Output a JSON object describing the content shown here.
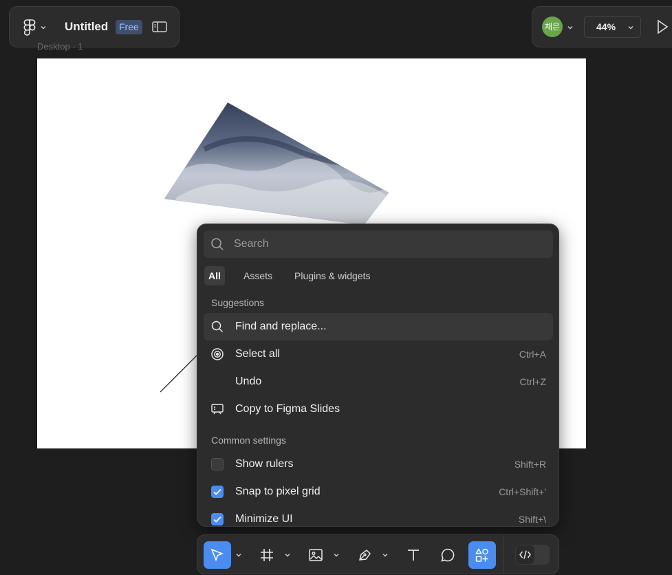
{
  "header": {
    "file_title": "Untitled",
    "plan_badge": "Free"
  },
  "toolbar_right": {
    "avatar_initials": "채은",
    "zoom_level": "44%"
  },
  "canvas": {
    "frame_name": "Desktop - 1"
  },
  "quick_actions": {
    "search_placeholder": "Search",
    "tabs": [
      {
        "label": "All",
        "active": true
      },
      {
        "label": "Assets",
        "active": false
      },
      {
        "label": "Plugins & widgets",
        "active": false
      }
    ],
    "sections": [
      {
        "title": "Suggestions",
        "items": [
          {
            "icon": "search-icon",
            "label": "Find and replace...",
            "shortcut": ""
          },
          {
            "icon": "target-icon",
            "label": "Select all",
            "shortcut": "Ctrl+A"
          },
          {
            "icon": "",
            "label": "Undo",
            "shortcut": "Ctrl+Z"
          },
          {
            "icon": "slides-icon",
            "label": "Copy to Figma Slides",
            "shortcut": ""
          }
        ]
      },
      {
        "title": "Common settings",
        "items": [
          {
            "checked": false,
            "label": "Show rulers",
            "shortcut": "Shift+R"
          },
          {
            "checked": true,
            "label": "Snap to pixel grid",
            "shortcut": "Ctrl+Shift+'"
          },
          {
            "checked": true,
            "label": "Minimize UI",
            "shortcut": "Shift+\\"
          }
        ]
      }
    ]
  },
  "bottom_toolbar": {
    "tools": [
      "move-tool",
      "frame-tool",
      "image-tool",
      "pen-tool",
      "text-tool",
      "comment-tool",
      "actions-tool"
    ],
    "active_tool": "actions-tool"
  },
  "colors": {
    "accent": "#4a8cf0",
    "panel": "#2c2c2c",
    "background": "#1e1e1e",
    "avatar": "#6aa54c"
  }
}
